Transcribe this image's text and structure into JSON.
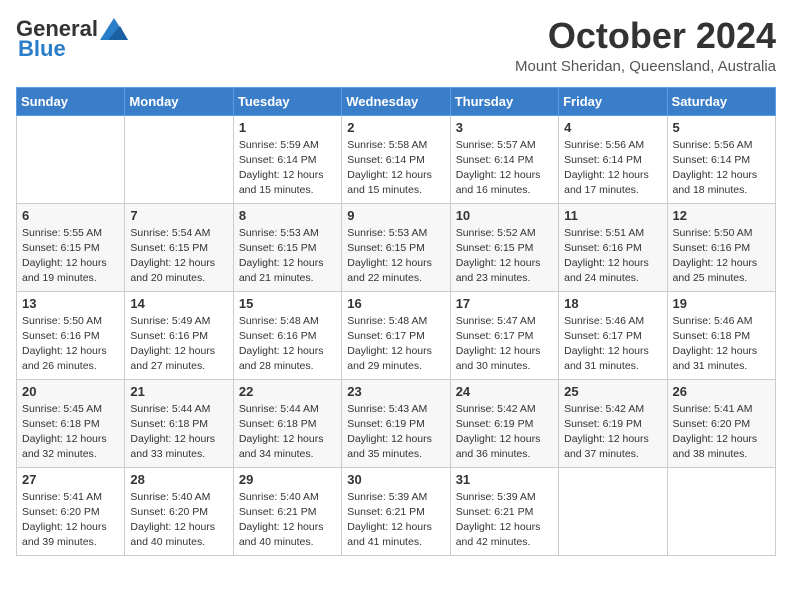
{
  "header": {
    "logo_general": "General",
    "logo_blue": "Blue",
    "month_title": "October 2024",
    "location": "Mount Sheridan, Queensland, Australia"
  },
  "weekdays": [
    "Sunday",
    "Monday",
    "Tuesday",
    "Wednesday",
    "Thursday",
    "Friday",
    "Saturday"
  ],
  "weeks": [
    [
      {
        "day": "",
        "info": ""
      },
      {
        "day": "",
        "info": ""
      },
      {
        "day": "1",
        "info": "Sunrise: 5:59 AM\nSunset: 6:14 PM\nDaylight: 12 hours and 15 minutes."
      },
      {
        "day": "2",
        "info": "Sunrise: 5:58 AM\nSunset: 6:14 PM\nDaylight: 12 hours and 15 minutes."
      },
      {
        "day": "3",
        "info": "Sunrise: 5:57 AM\nSunset: 6:14 PM\nDaylight: 12 hours and 16 minutes."
      },
      {
        "day": "4",
        "info": "Sunrise: 5:56 AM\nSunset: 6:14 PM\nDaylight: 12 hours and 17 minutes."
      },
      {
        "day": "5",
        "info": "Sunrise: 5:56 AM\nSunset: 6:14 PM\nDaylight: 12 hours and 18 minutes."
      }
    ],
    [
      {
        "day": "6",
        "info": "Sunrise: 5:55 AM\nSunset: 6:15 PM\nDaylight: 12 hours and 19 minutes."
      },
      {
        "day": "7",
        "info": "Sunrise: 5:54 AM\nSunset: 6:15 PM\nDaylight: 12 hours and 20 minutes."
      },
      {
        "day": "8",
        "info": "Sunrise: 5:53 AM\nSunset: 6:15 PM\nDaylight: 12 hours and 21 minutes."
      },
      {
        "day": "9",
        "info": "Sunrise: 5:53 AM\nSunset: 6:15 PM\nDaylight: 12 hours and 22 minutes."
      },
      {
        "day": "10",
        "info": "Sunrise: 5:52 AM\nSunset: 6:15 PM\nDaylight: 12 hours and 23 minutes."
      },
      {
        "day": "11",
        "info": "Sunrise: 5:51 AM\nSunset: 6:16 PM\nDaylight: 12 hours and 24 minutes."
      },
      {
        "day": "12",
        "info": "Sunrise: 5:50 AM\nSunset: 6:16 PM\nDaylight: 12 hours and 25 minutes."
      }
    ],
    [
      {
        "day": "13",
        "info": "Sunrise: 5:50 AM\nSunset: 6:16 PM\nDaylight: 12 hours and 26 minutes."
      },
      {
        "day": "14",
        "info": "Sunrise: 5:49 AM\nSunset: 6:16 PM\nDaylight: 12 hours and 27 minutes."
      },
      {
        "day": "15",
        "info": "Sunrise: 5:48 AM\nSunset: 6:16 PM\nDaylight: 12 hours and 28 minutes."
      },
      {
        "day": "16",
        "info": "Sunrise: 5:48 AM\nSunset: 6:17 PM\nDaylight: 12 hours and 29 minutes."
      },
      {
        "day": "17",
        "info": "Sunrise: 5:47 AM\nSunset: 6:17 PM\nDaylight: 12 hours and 30 minutes."
      },
      {
        "day": "18",
        "info": "Sunrise: 5:46 AM\nSunset: 6:17 PM\nDaylight: 12 hours and 31 minutes."
      },
      {
        "day": "19",
        "info": "Sunrise: 5:46 AM\nSunset: 6:18 PM\nDaylight: 12 hours and 31 minutes."
      }
    ],
    [
      {
        "day": "20",
        "info": "Sunrise: 5:45 AM\nSunset: 6:18 PM\nDaylight: 12 hours and 32 minutes."
      },
      {
        "day": "21",
        "info": "Sunrise: 5:44 AM\nSunset: 6:18 PM\nDaylight: 12 hours and 33 minutes."
      },
      {
        "day": "22",
        "info": "Sunrise: 5:44 AM\nSunset: 6:18 PM\nDaylight: 12 hours and 34 minutes."
      },
      {
        "day": "23",
        "info": "Sunrise: 5:43 AM\nSunset: 6:19 PM\nDaylight: 12 hours and 35 minutes."
      },
      {
        "day": "24",
        "info": "Sunrise: 5:42 AM\nSunset: 6:19 PM\nDaylight: 12 hours and 36 minutes."
      },
      {
        "day": "25",
        "info": "Sunrise: 5:42 AM\nSunset: 6:19 PM\nDaylight: 12 hours and 37 minutes."
      },
      {
        "day": "26",
        "info": "Sunrise: 5:41 AM\nSunset: 6:20 PM\nDaylight: 12 hours and 38 minutes."
      }
    ],
    [
      {
        "day": "27",
        "info": "Sunrise: 5:41 AM\nSunset: 6:20 PM\nDaylight: 12 hours and 39 minutes."
      },
      {
        "day": "28",
        "info": "Sunrise: 5:40 AM\nSunset: 6:20 PM\nDaylight: 12 hours and 40 minutes."
      },
      {
        "day": "29",
        "info": "Sunrise: 5:40 AM\nSunset: 6:21 PM\nDaylight: 12 hours and 40 minutes."
      },
      {
        "day": "30",
        "info": "Sunrise: 5:39 AM\nSunset: 6:21 PM\nDaylight: 12 hours and 41 minutes."
      },
      {
        "day": "31",
        "info": "Sunrise: 5:39 AM\nSunset: 6:21 PM\nDaylight: 12 hours and 42 minutes."
      },
      {
        "day": "",
        "info": ""
      },
      {
        "day": "",
        "info": ""
      }
    ]
  ]
}
